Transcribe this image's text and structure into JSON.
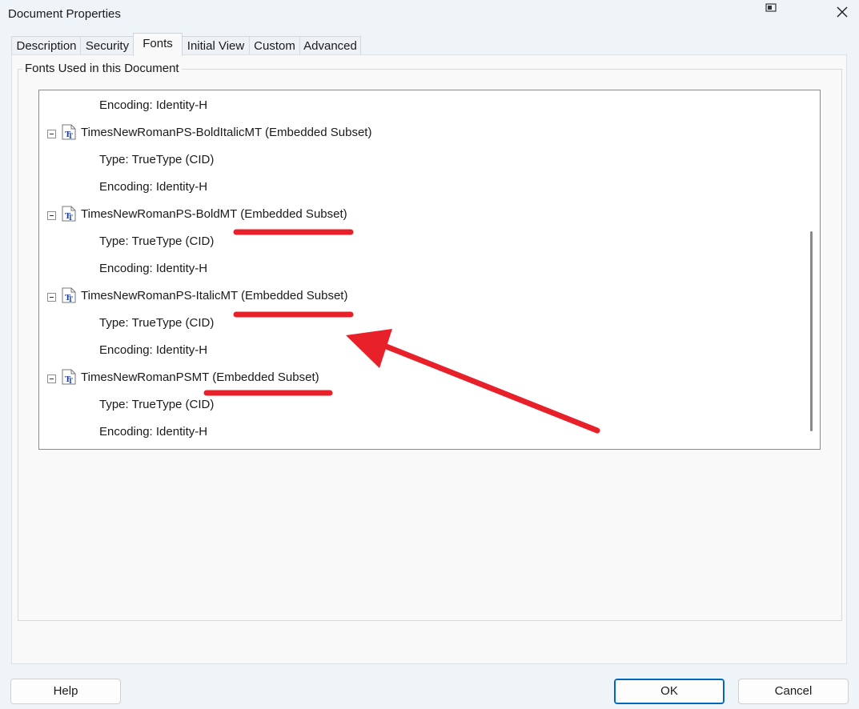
{
  "window": {
    "title": "Document Properties"
  },
  "tabs": [
    {
      "label": "Description"
    },
    {
      "label": "Security"
    },
    {
      "label": "Fonts"
    },
    {
      "label": "Initial View"
    },
    {
      "label": "Custom"
    },
    {
      "label": "Advanced"
    }
  ],
  "active_tab": "Fonts",
  "fonts_group": {
    "title": "Fonts Used in this Document",
    "rows": [
      {
        "text": "Encoding: Identity-H"
      },
      {
        "text": "TimesNewRomanPS-BoldItalicMT (Embedded Subset)"
      },
      {
        "text": "Type: TrueType (CID)"
      },
      {
        "text": "Encoding: Identity-H"
      },
      {
        "text": "TimesNewRomanPS-BoldMT (Embedded Subset)"
      },
      {
        "text": "Type: TrueType (CID)"
      },
      {
        "text": "Encoding: Identity-H"
      },
      {
        "text": "TimesNewRomanPS-ItalicMT (Embedded Subset)"
      },
      {
        "text": "Type: TrueType (CID)"
      },
      {
        "text": "Encoding: Identity-H"
      },
      {
        "text": "TimesNewRomanPSMT (Embedded Subset)"
      },
      {
        "text": "Type: TrueType (CID)"
      },
      {
        "text": "Encoding: Identity-H"
      }
    ]
  },
  "buttons": {
    "help": "Help",
    "ok": "OK",
    "cancel": "Cancel"
  },
  "annotation_color": "#e8202a",
  "icons": {
    "font_icon": "truetype-font-icon",
    "collapse": "minus-box-icon"
  }
}
